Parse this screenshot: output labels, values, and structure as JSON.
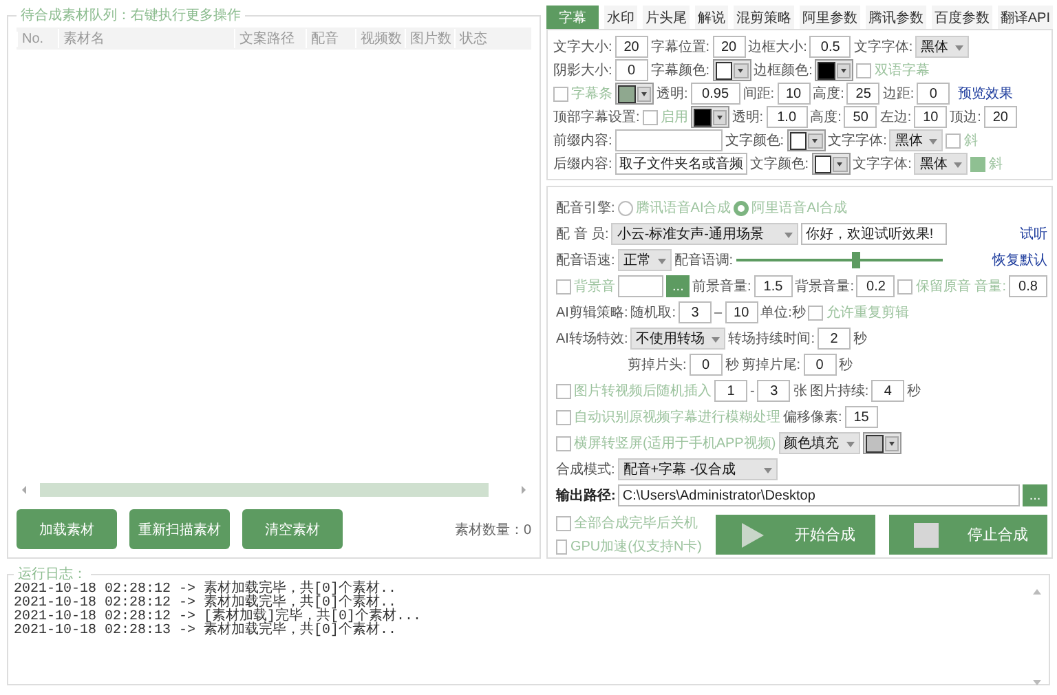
{
  "queue": {
    "title": "待合成素材队列：右键执行更多操作",
    "columns": [
      "No.",
      "素材名",
      "文案路径",
      "配音",
      "视频数",
      "图片数",
      "状态"
    ],
    "count_label": "素材数量：0"
  },
  "queue_buttons": [
    "加载素材",
    "重新扫描素材",
    "清空素材"
  ],
  "tabs": [
    {
      "label": "字幕",
      "selected": true
    },
    {
      "label": "水印",
      "selected": false
    },
    {
      "label": "片头尾",
      "selected": false
    },
    {
      "label": "解说",
      "selected": false
    },
    {
      "label": "混剪策略",
      "selected": false
    },
    {
      "label": "阿里参数",
      "selected": false
    },
    {
      "label": "腾讯参数",
      "selected": false
    },
    {
      "label": "百度参数",
      "selected": false
    },
    {
      "label": "翻译API",
      "selected": false
    }
  ],
  "subtitle_rows": [
    {
      "items": [
        {
          "kind": "label",
          "text": "文字大小:"
        },
        {
          "kind": "number",
          "value": "20"
        },
        {
          "kind": "label",
          "text": "字幕位置:"
        },
        {
          "kind": "number",
          "value": "20"
        },
        {
          "kind": "label",
          "text": "边框大小:"
        },
        {
          "kind": "number",
          "value": "0.5"
        },
        {
          "kind": "label",
          "text": "文字字体:"
        },
        {
          "kind": "select",
          "value": "黑体"
        }
      ]
    },
    {
      "items": [
        {
          "kind": "label",
          "text": "阴影大小:"
        },
        {
          "kind": "number",
          "value": "0"
        },
        {
          "kind": "label",
          "text": "字幕颜色:"
        },
        {
          "kind": "color",
          "color": "#ffffff"
        },
        {
          "kind": "label",
          "text": "边框颜色:"
        },
        {
          "kind": "color",
          "color": "#000000"
        },
        {
          "kind": "checkbox",
          "label": "双语字幕",
          "checked": false,
          "disabled": true
        }
      ]
    },
    {
      "items": [
        {
          "kind": "checkbox",
          "label": "字幕条",
          "checked": false,
          "disabled": true
        },
        {
          "kind": "color",
          "color": "#8fa88f"
        },
        {
          "kind": "label",
          "text": "透明:"
        },
        {
          "kind": "number",
          "value": "0.95"
        },
        {
          "kind": "label",
          "text": "间距:"
        },
        {
          "kind": "number",
          "value": "10"
        },
        {
          "kind": "label",
          "text": "高度:"
        },
        {
          "kind": "number",
          "value": "25"
        },
        {
          "kind": "label",
          "text": "边距:"
        },
        {
          "kind": "number",
          "value": "0"
        },
        {
          "kind": "link",
          "text": "预览效果"
        }
      ]
    },
    {
      "items": [
        {
          "kind": "label",
          "text": "顶部字幕设置:"
        },
        {
          "kind": "checkbox",
          "label": "启用",
          "checked": false,
          "disabled": true
        },
        {
          "kind": "color",
          "color": "#000000"
        },
        {
          "kind": "label",
          "text": "透明:"
        },
        {
          "kind": "number",
          "value": "1.0"
        },
        {
          "kind": "label",
          "text": "高度:"
        },
        {
          "kind": "number",
          "value": "50"
        },
        {
          "kind": "label",
          "text": "左边:"
        },
        {
          "kind": "number",
          "value": "10"
        },
        {
          "kind": "label",
          "text": "顶边:"
        },
        {
          "kind": "number",
          "value": "20"
        }
      ]
    },
    {
      "items": [
        {
          "kind": "label",
          "text": "前缀内容:"
        },
        {
          "kind": "text"
        },
        {
          "kind": "label",
          "text": "文字颜色:"
        },
        {
          "kind": "color",
          "color": "#ffffff"
        },
        {
          "kind": "label",
          "text": "文字字体:"
        },
        {
          "kind": "select",
          "value": "黑体"
        },
        {
          "kind": "checkbox",
          "label": "斜",
          "checked": false,
          "disabled": true
        }
      ]
    },
    {
      "items": [
        {
          "kind": "label",
          "text": "后缀内容:"
        },
        {
          "kind": "text",
          "value": "取子文件夹名或音频"
        },
        {
          "kind": "label",
          "text": "文字颜色:"
        },
        {
          "kind": "color",
          "color": "#ffffff"
        },
        {
          "kind": "label",
          "text": "文字字体:"
        },
        {
          "kind": "select",
          "value": "黑体"
        },
        {
          "kind": "checkbox",
          "label": "斜",
          "checked": true,
          "disabled": true
        }
      ]
    }
  ],
  "settings_rows": [
    {
      "items": [
        {
          "kind": "label",
          "text": "配音引擎:"
        },
        {
          "kind": "radio",
          "label": "腾讯语音AI合成",
          "selected": false,
          "disabled": true
        },
        {
          "kind": "radio",
          "label": "阿里语音AI合成",
          "selected": true,
          "disabled": true
        }
      ]
    },
    {
      "items": [
        {
          "kind": "label",
          "text": "配 音 员:"
        },
        {
          "kind": "select",
          "value": "小云-标准女声-通用场景"
        },
        {
          "kind": "text",
          "value": "你好，欢迎试听效果!"
        },
        {
          "kind": "link",
          "text": "试听"
        }
      ]
    },
    {
      "items": [
        {
          "kind": "label",
          "text": "配音语速:"
        },
        {
          "kind": "select",
          "value": "正常"
        },
        {
          "kind": "label",
          "text": "配音语调:"
        },
        {
          "kind": "slider",
          "level": 0.58
        },
        {
          "kind": "link",
          "text": "恢复默认"
        }
      ]
    },
    {
      "items": [
        {
          "kind": "checkbox",
          "label": "背景音",
          "checked": false,
          "disabled": true
        },
        {
          "kind": "text"
        },
        {
          "kind": "browse",
          "text": "..."
        },
        {
          "kind": "label",
          "text": "前景音量:"
        },
        {
          "kind": "number",
          "value": "1.5"
        },
        {
          "kind": "label",
          "text": "背景音量:"
        },
        {
          "kind": "number",
          "value": "0.2"
        },
        {
          "kind": "checkbox",
          "label": "保留原音 音量:",
          "checked": false,
          "disabled": true
        },
        {
          "kind": "number",
          "value": "0.8"
        }
      ]
    },
    {
      "items": [
        {
          "kind": "label",
          "text": "AI剪辑策略:"
        },
        {
          "kind": "label",
          "text": "随机取:"
        },
        {
          "kind": "number",
          "value": "3"
        },
        {
          "kind": "label",
          "text": "–"
        },
        {
          "kind": "number",
          "value": "10"
        },
        {
          "kind": "label",
          "text": "单位:秒"
        },
        {
          "kind": "checkbox",
          "label": "允许重复剪辑",
          "checked": false,
          "disabled": true
        }
      ]
    },
    {
      "items": [
        {
          "kind": "label",
          "text": "AI转场特效:"
        },
        {
          "kind": "select",
          "value": "不使用转场"
        },
        {
          "kind": "label",
          "text": "转场持续时间:"
        },
        {
          "kind": "number",
          "value": "2"
        },
        {
          "kind": "label",
          "text": "秒"
        }
      ]
    },
    {
      "items": [
        {
          "kind": "label",
          "text": "剪掉片头:"
        },
        {
          "kind": "number",
          "value": "0"
        },
        {
          "kind": "label",
          "text": "秒"
        },
        {
          "kind": "label",
          "text": "剪掉片尾:"
        },
        {
          "kind": "number",
          "value": "0"
        },
        {
          "kind": "label",
          "text": "秒"
        }
      ]
    },
    {
      "items": [
        {
          "kind": "checkbox",
          "label": "图片转视频后随机插入",
          "checked": false,
          "disabled": true
        },
        {
          "kind": "number",
          "value": "1"
        },
        {
          "kind": "label",
          "text": "-"
        },
        {
          "kind": "number",
          "value": "3"
        },
        {
          "kind": "label",
          "text": "张"
        },
        {
          "kind": "label",
          "text": "图片持续:"
        },
        {
          "kind": "number",
          "value": "4"
        },
        {
          "kind": "label",
          "text": "秒"
        }
      ]
    },
    {
      "items": [
        {
          "kind": "checkbox",
          "label": "自动识别原视频字幕进行模糊处理",
          "checked": false,
          "disabled": true
        },
        {
          "kind": "label",
          "text": "偏移像素:"
        },
        {
          "kind": "number",
          "value": "15"
        }
      ]
    },
    {
      "items": [
        {
          "kind": "checkbox",
          "label": "横屏转竖屏(适用于手机APP视频)",
          "checked": false,
          "disabled": true
        },
        {
          "kind": "select",
          "value": "颜色填充"
        },
        {
          "kind": "color",
          "color": "#c0c0c0"
        }
      ]
    },
    {
      "items": [
        {
          "kind": "label",
          "text": "合成模式:"
        },
        {
          "kind": "select",
          "value": "配音+字幕 -仅合成"
        }
      ]
    },
    {
      "items": [
        {
          "kind": "strong_label",
          "text": "输出路径:"
        },
        {
          "kind": "text",
          "value": "C:\\Users\\Administrator\\Desktop"
        },
        {
          "kind": "browse",
          "text": "..."
        }
      ]
    }
  ],
  "options": [
    {
      "label": "全部合成完毕后关机",
      "checked": false,
      "disabled": true
    },
    {
      "label": "GPU加速(仅支持N卡)",
      "checked": false,
      "disabled": true
    }
  ],
  "actions": [
    {
      "kind": "start",
      "label": "开始合成"
    },
    {
      "kind": "stop",
      "label": "停止合成"
    }
  ],
  "log": {
    "title": "运行日志：",
    "lines": [
      "2021-10-18 02:28:12 -> 素材加载完毕，共[0]个素材..",
      "2021-10-18 02:28:12 -> 素材加载完毕，共[0]个素材..",
      "2021-10-18 02:28:12 -> [素材加载]完毕，共[0]个素材...",
      "2021-10-18 02:28:13 -> 素材加载完毕，共[0]个素材.."
    ]
  }
}
